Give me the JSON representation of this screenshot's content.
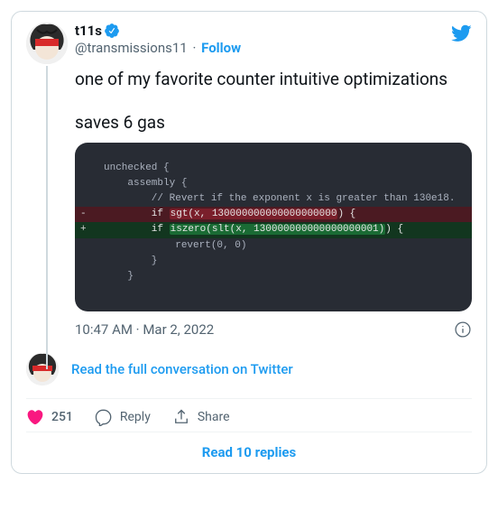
{
  "author": {
    "display_name": "t11s",
    "handle": "@transmissions11",
    "follow_label": "Follow"
  },
  "tweet": {
    "line1": "one of my favorite counter intuitive optimizations",
    "line2": "saves 6 gas"
  },
  "code": {
    "l1": "unchecked {",
    "l2": "    assembly {",
    "l3": "        // Revert if the exponent x is greater than 130e18.",
    "l4_if": "        if ",
    "l4_hl": "sgt(x, 130000000000000000000",
    "l4_tail": ") {",
    "l5_if": "        if ",
    "l5_hl": "iszero(slt(x, 130000000000000000001)",
    "l5_tail": ") {",
    "l6": "            revert(0, 0)",
    "l7": "        }",
    "l8": "    }"
  },
  "timestamp": "10:47 AM · Mar 2, 2022",
  "convo_link": "Read the full conversation on Twitter",
  "actions": {
    "like_count": "251",
    "reply_label": "Reply",
    "share_label": "Share"
  },
  "replies_link": "Read 10 replies"
}
